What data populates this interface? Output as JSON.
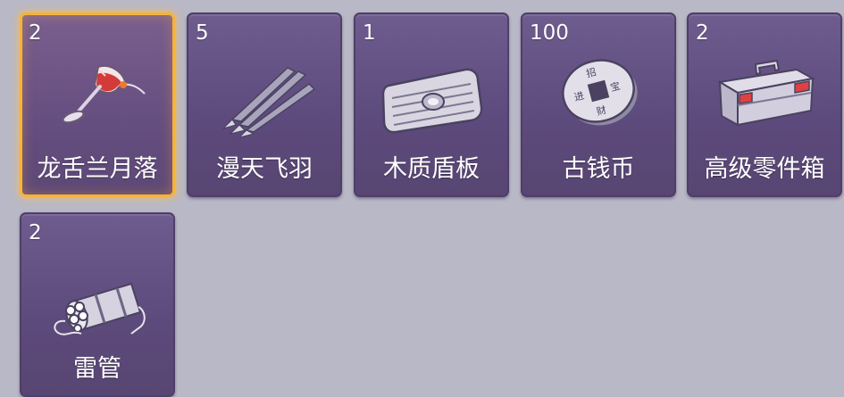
{
  "inventory": {
    "items": [
      {
        "count": "2",
        "name": "龙舌兰月落",
        "icon": "cocktail-glass-icon",
        "selected": true
      },
      {
        "count": "5",
        "name": "漫天飞羽",
        "icon": "feather-darts-icon",
        "selected": false
      },
      {
        "count": "1",
        "name": "木质盾板",
        "icon": "shield-plate-icon",
        "selected": false
      },
      {
        "count": "100",
        "name": "古钱币",
        "icon": "ancient-coin-icon",
        "selected": false
      },
      {
        "count": "2",
        "name": "高级零件箱",
        "icon": "toolbox-icon",
        "selected": false
      },
      {
        "count": "2",
        "name": "雷管",
        "icon": "detonator-bundle-icon",
        "selected": false
      }
    ]
  },
  "colors": {
    "background": "#b9b8c6",
    "slot": "#5d4a7c",
    "selected_border": "#f6b33a",
    "text": "#ffffff"
  }
}
